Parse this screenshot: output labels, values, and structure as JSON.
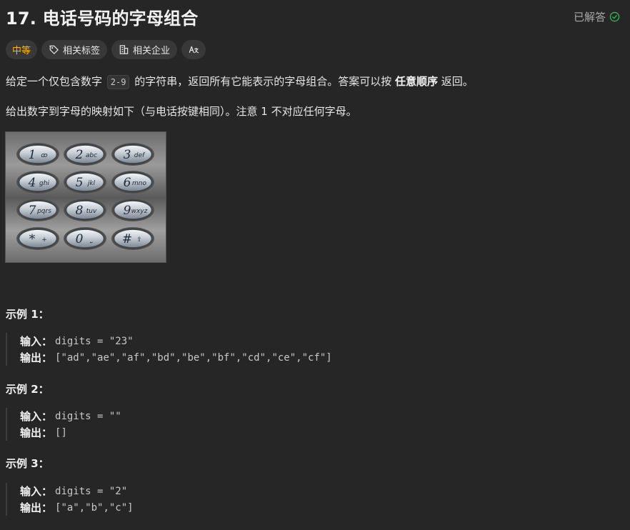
{
  "problem": {
    "title": "17. 电话号码的字母组合",
    "solved_label": "已解答",
    "difficulty": "中等",
    "tag_related": "相关标签",
    "tag_company": "相关企业",
    "translate_glyph": "Aあ"
  },
  "description": {
    "line1_pre": "给定一个仅包含数字 ",
    "line1_code": "2-9",
    "line1_mid": " 的字符串，返回所有它能表示的字母组合。答案可以按 ",
    "line1_bold": "任意顺序",
    "line1_post": " 返回。",
    "line2": "给出数字到字母的映射如下（与电话按键相同）。注意 1 不对应任何字母。"
  },
  "keypad": {
    "keys": [
      {
        "digit": "1",
        "letters": "ꝏ"
      },
      {
        "digit": "2",
        "letters": "abc"
      },
      {
        "digit": "3",
        "letters": "def"
      },
      {
        "digit": "4",
        "letters": "ghi"
      },
      {
        "digit": "5",
        "letters": "jkl"
      },
      {
        "digit": "6",
        "letters": "mno"
      },
      {
        "digit": "7",
        "letters": "pqrs"
      },
      {
        "digit": "8",
        "letters": "tuv"
      },
      {
        "digit": "9",
        "letters": "wxyz"
      },
      {
        "digit": "*",
        "letters": "+"
      },
      {
        "digit": "0",
        "letters": "⎵"
      },
      {
        "digit": "#",
        "letters": "⇧"
      }
    ]
  },
  "examples": [
    {
      "title": "示例 1：",
      "input_label": "输入：",
      "input": "digits = \"23\"",
      "output_label": "输出：",
      "output": "[\"ad\",\"ae\",\"af\",\"bd\",\"be\",\"bf\",\"cd\",\"ce\",\"cf\"]"
    },
    {
      "title": "示例 2：",
      "input_label": "输入：",
      "input": "digits = \"\"",
      "output_label": "输出：",
      "output": "[]"
    },
    {
      "title": "示例 3：",
      "input_label": "输入：",
      "input": "digits = \"2\"",
      "output_label": "输出：",
      "output": "[\"a\",\"b\",\"c\"]"
    }
  ],
  "colors": {
    "background": "#262626",
    "difficulty_medium": "#ffb800",
    "solved_check": "#2cbb5d"
  }
}
